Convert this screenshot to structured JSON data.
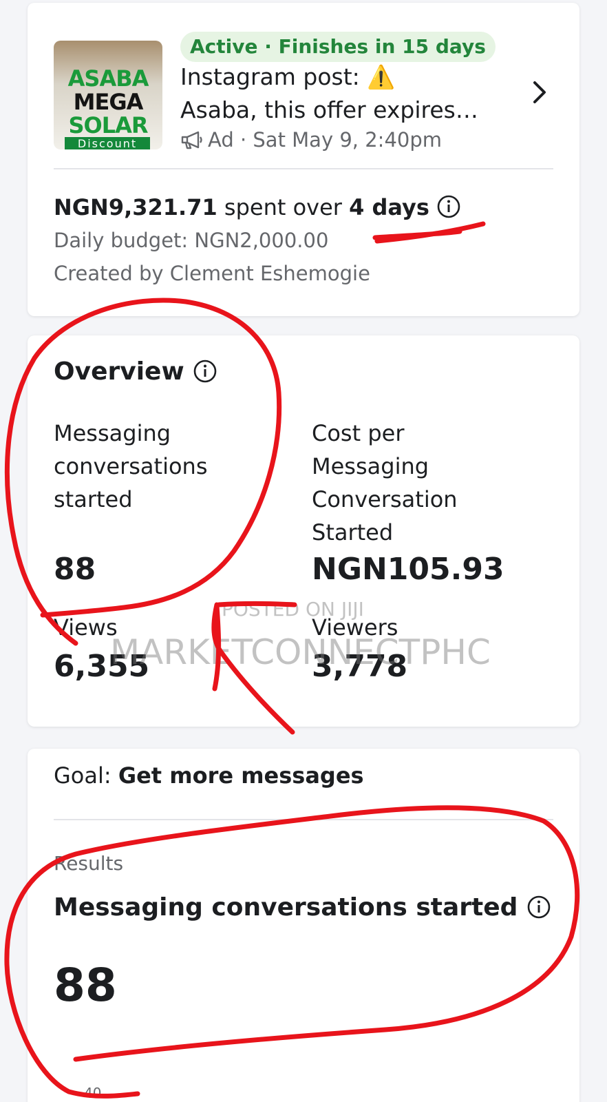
{
  "ad_card": {
    "thumbnail": {
      "line1": "ASABA",
      "line2": "MEGA",
      "line3": "SOLAR",
      "line4": "Discount"
    },
    "status": "Active · Finishes in 15 days",
    "title_line1": "Instagram post:",
    "title_warning": "⚠️",
    "title_line2": "Asaba, this offer expires…",
    "meta": "Ad · Sat May 9, 2:40pm",
    "spent_amount": "NGN9,321.71",
    "spent_over": " spent over ",
    "spent_days": "4 days",
    "daily_budget": "Daily budget: NGN2,000.00",
    "created_by": "Created by Clement Eshemogie"
  },
  "overview": {
    "title": "Overview",
    "metrics": [
      {
        "label": "Messaging conversations started",
        "value": "88"
      },
      {
        "label": "Cost per Messaging Conversation Started",
        "value": "NGN105.93"
      },
      {
        "label": "Views",
        "value": "6,355"
      },
      {
        "label": "Viewers",
        "value": "3,778"
      }
    ]
  },
  "goal_card": {
    "goal_prefix": "Goal: ",
    "goal_value": "Get more messages",
    "results_label": "Results",
    "results_metric": "Messaging conversations started",
    "results_value": "88",
    "axis_tick": "40"
  },
  "watermark": {
    "line1": "POSTED ON JIJI",
    "line2": "MARKETCONNECTPHC"
  },
  "colors": {
    "status_green": "#23853b",
    "status_bg": "#e6f4e3",
    "annotation_red": "#e8141b",
    "muted_text": "#65676b"
  },
  "icons": {
    "chevron": "chevron-right-icon",
    "info": "info-icon",
    "megaphone": "megaphone-icon"
  }
}
